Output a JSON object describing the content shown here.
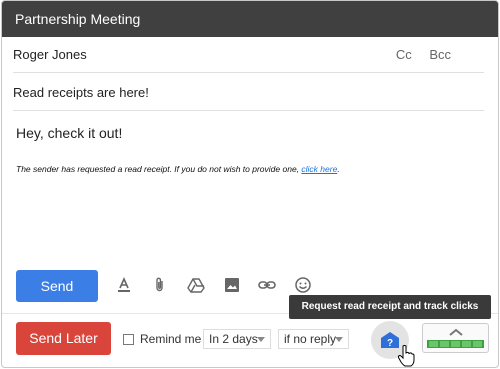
{
  "window": {
    "title": "Partnership Meeting"
  },
  "compose": {
    "to": "Roger Jones",
    "cc_label": "Cc",
    "bcc_label": "Bcc",
    "subject": "Read receipts are here!",
    "body": "Hey, check it out!",
    "notice_text": "The sender has requested a read receipt. If you do not wish to provide one, ",
    "notice_link": "click here",
    "notice_end": "."
  },
  "toolbar": {
    "send_label": "Send",
    "icons": [
      "text-format-icon",
      "attach-icon",
      "drive-icon",
      "image-icon",
      "link-icon",
      "emoji-icon"
    ]
  },
  "schedule": {
    "send_later_label": "Send Later",
    "remind_label": "Remind me",
    "remind_checked": false,
    "days_value": "In 2 days",
    "condition_value": "if no reply"
  },
  "tooltip": {
    "text": "Request read receipt and track clicks"
  },
  "colors": {
    "send": "#3b7fe6",
    "send_later": "#d9453a",
    "titlebar": "#404040",
    "tracker_fill": "#3da13d"
  }
}
